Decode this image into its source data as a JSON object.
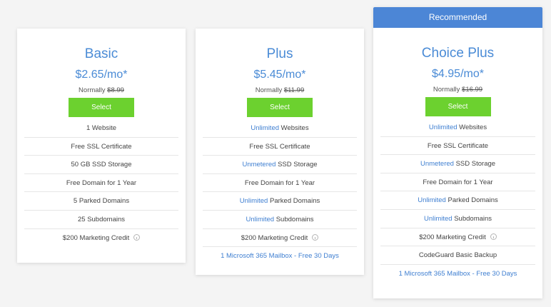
{
  "plans": [
    {
      "title": "Basic",
      "price": "$2.65/mo*",
      "normally_label": "Normally",
      "normally_price": "$8.99",
      "select_label": "Select",
      "features": [
        {
          "hl": "",
          "text": "1 Website"
        },
        {
          "hl": "",
          "text": "Free SSL Certificate"
        },
        {
          "hl": "",
          "text": "50 GB SSD Storage"
        },
        {
          "hl": "",
          "text": "Free Domain for 1 Year"
        },
        {
          "hl": "",
          "text": "5 Parked Domains"
        },
        {
          "hl": "",
          "text": "25 Subdomains"
        },
        {
          "hl": "",
          "text": "$200 Marketing Credit"
        }
      ]
    },
    {
      "title": "Plus",
      "price": "$5.45/mo*",
      "normally_label": "Normally",
      "normally_price": "$11.99",
      "select_label": "Select",
      "features": [
        {
          "hl": "Unlimited",
          "text": " Websites"
        },
        {
          "hl": "",
          "text": "Free SSL Certificate"
        },
        {
          "hl": "Unmetered",
          "text": " SSD Storage"
        },
        {
          "hl": "",
          "text": "Free Domain for 1 Year"
        },
        {
          "hl": "Unlimited",
          "text": " Parked Domains"
        },
        {
          "hl": "Unlimited",
          "text": " Subdomains"
        },
        {
          "hl": "",
          "text": "$200 Marketing Credit"
        }
      ],
      "link": "1 Microsoft 365 Mailbox - Free 30 Days"
    },
    {
      "recommended": "Recommended",
      "title": "Choice Plus",
      "price": "$4.95/mo*",
      "normally_label": "Normally",
      "normally_price": "$16.99",
      "select_label": "Select",
      "features": [
        {
          "hl": "Unlimited",
          "text": " Websites"
        },
        {
          "hl": "",
          "text": "Free SSL Certificate"
        },
        {
          "hl": "Unmetered",
          "text": " SSD Storage"
        },
        {
          "hl": "",
          "text": "Free Domain for 1 Year"
        },
        {
          "hl": "Unlimited",
          "text": " Parked Domains"
        },
        {
          "hl": "Unlimited",
          "text": " Subdomains"
        },
        {
          "hl": "",
          "text": "$200 Marketing Credit"
        },
        {
          "hl": "",
          "text": "CodeGuard Basic Backup"
        }
      ],
      "link": "1 Microsoft 365 Mailbox - Free 30 Days"
    }
  ],
  "colors": {
    "accent_blue": "#4a8bd6",
    "button_green": "#6cd12f",
    "banner_blue": "#4c86d6"
  }
}
